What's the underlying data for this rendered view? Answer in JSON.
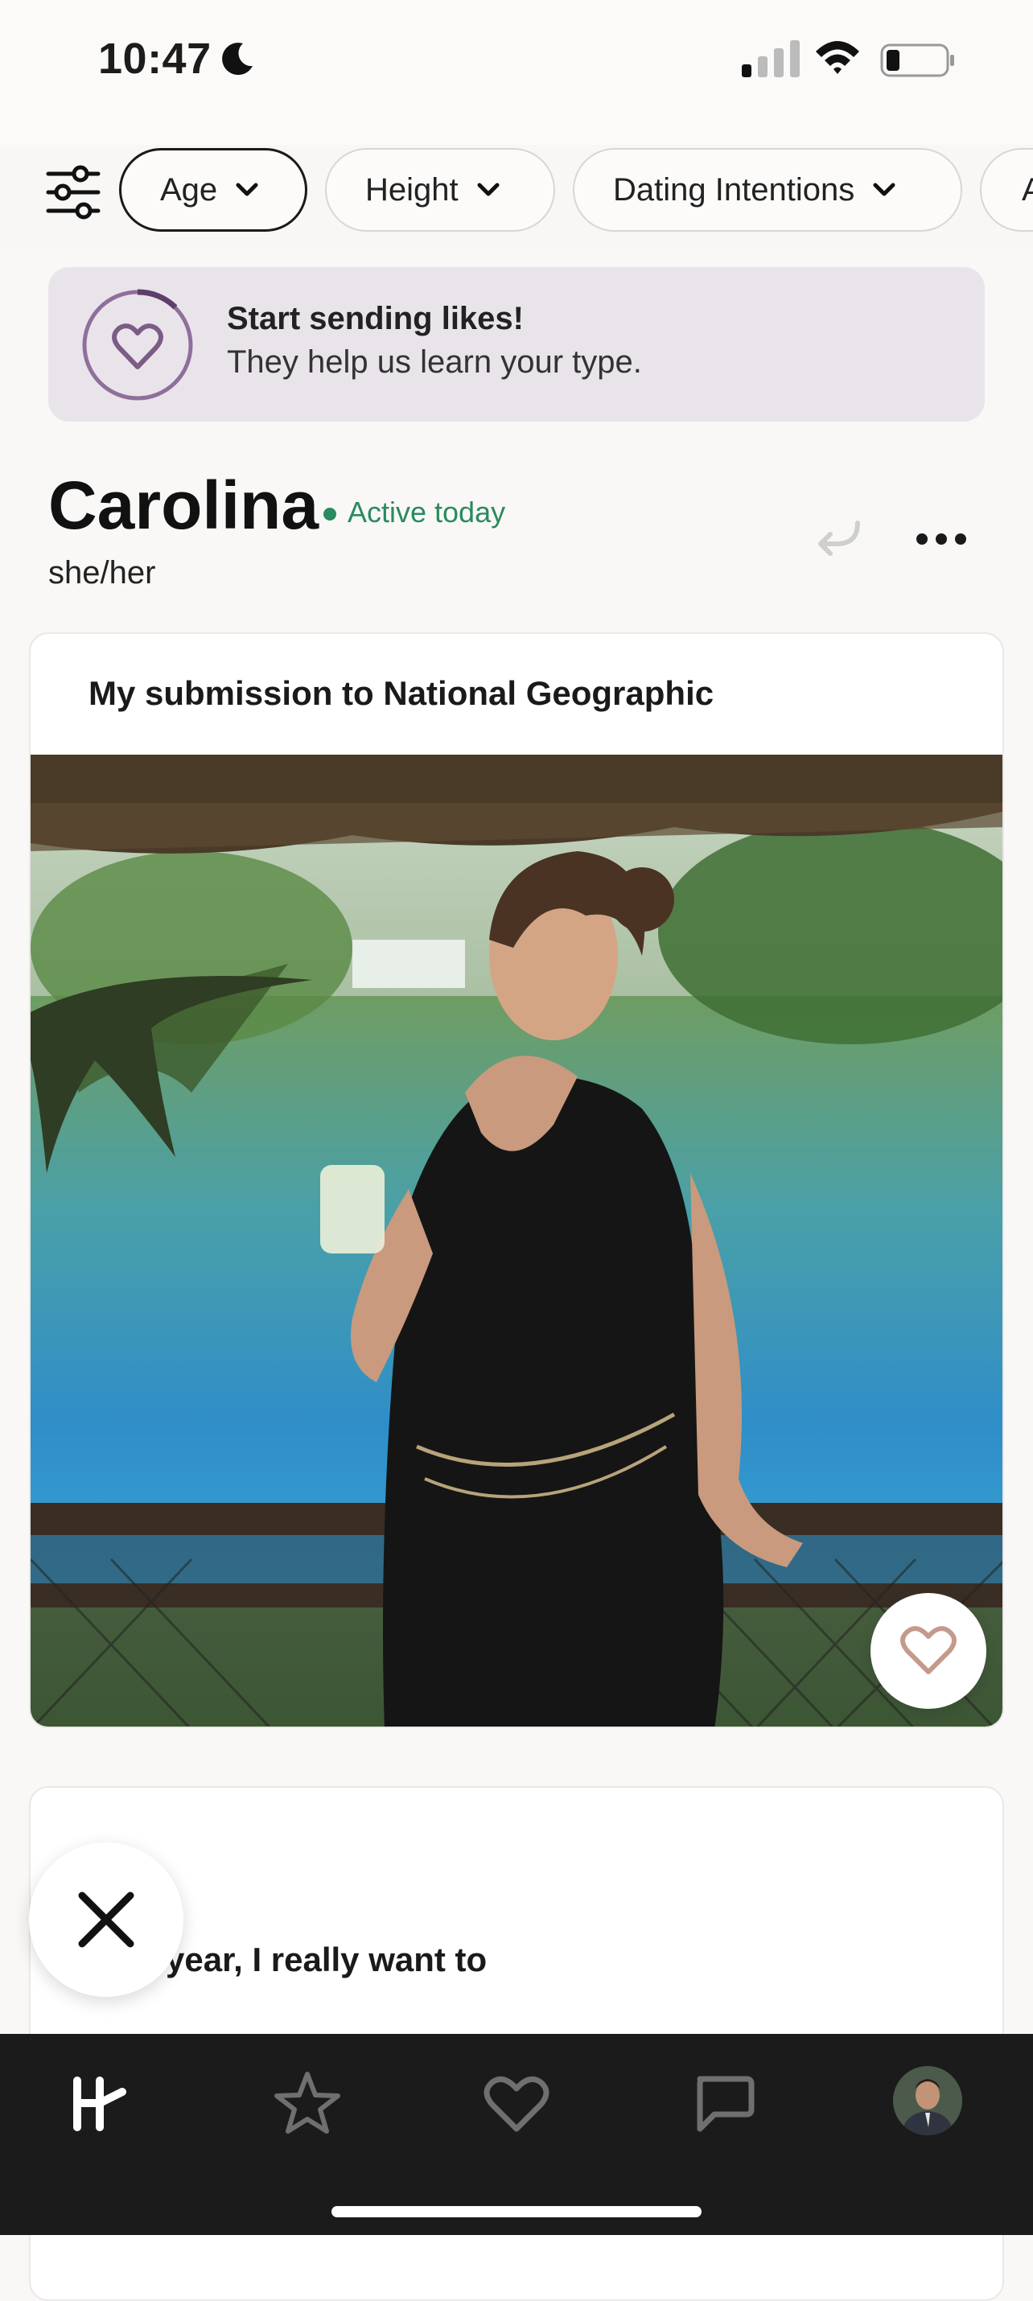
{
  "status_bar": {
    "time": "10:47",
    "icons": [
      "moon-icon",
      "cellular-signal-icon",
      "wifi-icon",
      "battery-icon"
    ]
  },
  "filters": {
    "icon": "filter-sliders-icon",
    "chips": [
      {
        "label": "Age",
        "active": true
      },
      {
        "label": "Height",
        "active": false
      },
      {
        "label": "Dating Intentions",
        "active": false
      },
      {
        "label": "A",
        "active": false
      }
    ]
  },
  "banner": {
    "icon": "heart-progress-icon",
    "title": "Start sending likes!",
    "subtitle": "They help us learn your type."
  },
  "profile": {
    "name": "Carolina",
    "status": "Active today",
    "pronouns": "she/her",
    "actions": [
      "undo-icon",
      "more-icon"
    ]
  },
  "card": {
    "prompt": "My submission to National Geographic",
    "photo_alt": "Woman in black dress holding a drink beside a lagoon",
    "like_icon": "heart-icon"
  },
  "card2": {
    "text": "year, I really want to"
  },
  "skip": {
    "icon": "close-icon"
  },
  "bottom_nav": {
    "items": [
      "discover-logo-icon",
      "standouts-star-icon",
      "likes-heart-icon",
      "matches-chat-icon",
      "profile-avatar"
    ]
  },
  "colors": {
    "active_green": "#2b8a5e",
    "banner_bg": "#e9e4ea",
    "accent_purple": "#7b5c86",
    "nav_bg": "#1b1b1b"
  }
}
